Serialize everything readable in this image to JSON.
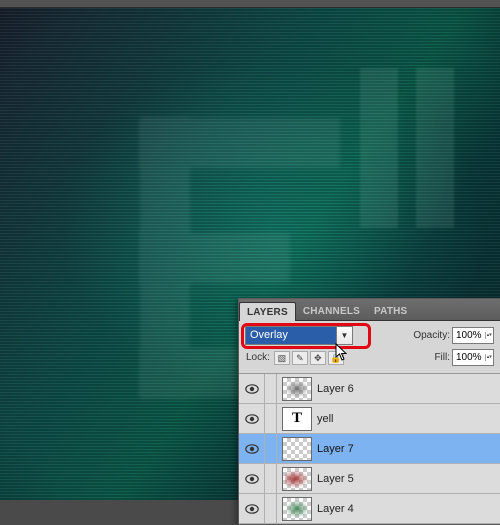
{
  "panel": {
    "tabs": {
      "layers": "LAYERS",
      "channels": "CHANNELS",
      "paths": "PATHS"
    },
    "blend_mode": "Overlay",
    "opacity": {
      "label": "Opacity:",
      "value": "100%"
    },
    "fill": {
      "label": "Fill:",
      "value": "100%"
    },
    "lock_label": "Lock:",
    "lock_icons": [
      "transparency-lock-icon",
      "brush-lock-icon",
      "move-lock-icon",
      "lock-all-icon"
    ]
  },
  "layers": [
    {
      "name": "Layer 6",
      "thumb": "checker",
      "smear": "gray",
      "selected": false,
      "type": "raster"
    },
    {
      "name": "yell",
      "thumb": "text",
      "smear": "",
      "selected": false,
      "type": "text"
    },
    {
      "name": "Layer 7",
      "thumb": "checker",
      "smear": "",
      "selected": true,
      "type": "raster"
    },
    {
      "name": "Layer 5",
      "thumb": "checker",
      "smear": "red",
      "selected": false,
      "type": "raster"
    },
    {
      "name": "Layer 4",
      "thumb": "checker",
      "smear": "green",
      "selected": false,
      "type": "raster"
    }
  ],
  "colors": {
    "highlight_red": "#e30613",
    "selection_blue": "#7db3f0"
  }
}
